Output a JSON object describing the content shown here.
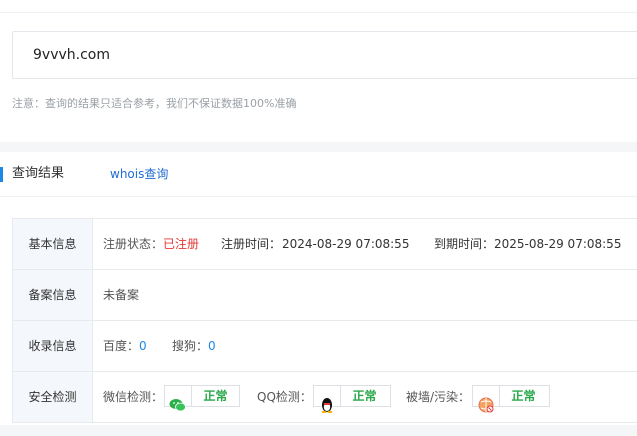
{
  "search": {
    "value": "9vvvh.com"
  },
  "notice": "注意：查询的结果只适合参考，我们不保证数据100%准确",
  "tabs": {
    "result": "查询结果",
    "whois": "whois查询"
  },
  "rows": {
    "basic": {
      "label": "基本信息",
      "status_label": "注册状态：",
      "status_value": "已注册",
      "reg_time_label": "注册时间：",
      "reg_time_value": "2024-08-29 07:08:55",
      "exp_time_label": "到期时间：",
      "exp_time_value": "2025-08-29 07:08:55"
    },
    "icp": {
      "label": "备案信息",
      "value": "未备案"
    },
    "index": {
      "label": "收录信息",
      "baidu_label": "百度：",
      "baidu_value": "0",
      "sogou_label": "搜狗：",
      "sogou_value": "0"
    },
    "security": {
      "label": "安全检测",
      "wechat_label": "微信检测：",
      "wechat_status": "正常",
      "qq_label": "QQ检测：",
      "qq_status": "正常",
      "wall_label": "被墙/污染：",
      "wall_status": "正常"
    }
  },
  "colors": {
    "accent": "#1e88e5",
    "link": "#1e6bd6",
    "registered": "#e53935",
    "ok": "#2aa84a"
  },
  "icons": [
    "wechat-icon",
    "qq-penguin-icon",
    "globe-block-icon"
  ]
}
